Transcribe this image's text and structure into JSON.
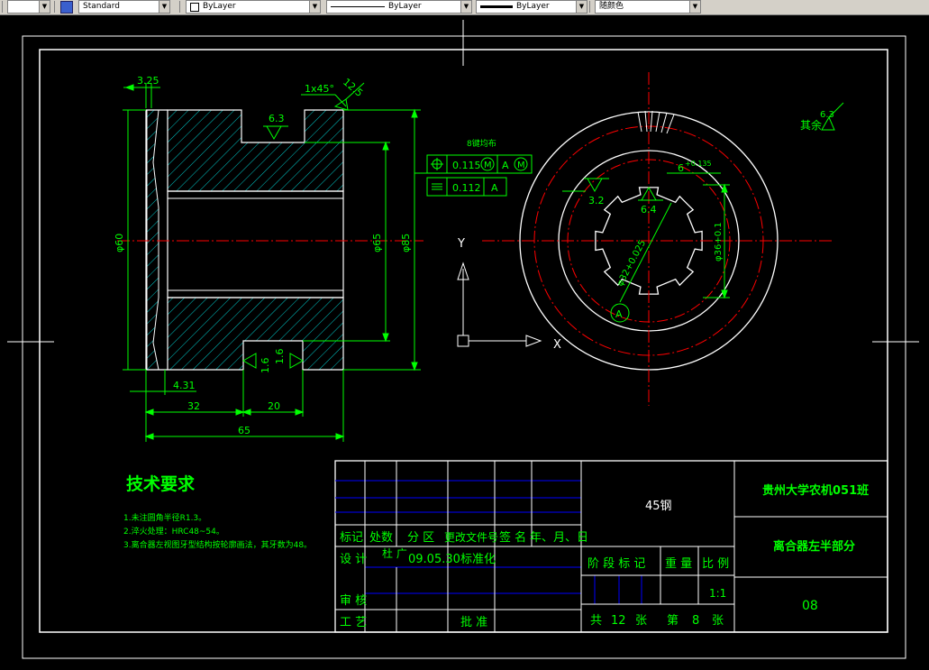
{
  "toolbar": {
    "text_style": "Standard",
    "layer": "ByLayer",
    "linetype": "ByLayer",
    "lineweight": "ByLayer",
    "color": "随颜色"
  },
  "colors": {
    "background": "#000000",
    "green": "#00ff00",
    "white": "#ffffff",
    "red": "#ff0000",
    "cyan": "#00c8c8",
    "blue": "#0000ff"
  },
  "drawing": {
    "dims": {
      "top_small": "3.25",
      "chamfer": "1x45°",
      "chamfer_angle": "12.5",
      "rough_top": "6.3",
      "dia_left": "φ60",
      "dia_65": "φ65",
      "dia_85": "φ85",
      "rough_b1": "1.6",
      "rough_b2": "1.6",
      "d431": "4.31",
      "d32": "32",
      "d20": "20",
      "d65": "65"
    },
    "tolerance": {
      "label": "8键均布",
      "row1_val": "0.115",
      "row1_m": "M",
      "row1_ref": "A",
      "row1_ref_m": "M",
      "row2_val": "0.112",
      "row2_ref": "A"
    },
    "right": {
      "dim6": "6",
      "dim6_tol": "+0.135",
      "r32": "3.2",
      "r64": "6.4",
      "d36": "φ36+0.1",
      "d32": "φ32+0.025",
      "datum": "A",
      "rest_label": "其余",
      "rest_rough": "6.3"
    },
    "ucs": {
      "y": "Y",
      "x": "X"
    },
    "tech": {
      "title": "技术要求",
      "line1": "1.未注圆角半径R1.3。",
      "line2": "2.淬火处理：HRC48~54。",
      "line3": "3.离合器左视图牙型结构按轮廓画法，其牙数为48。"
    },
    "title_block": {
      "material": "45钢",
      "school": "贵州大学农机051班",
      "part_name": "离合器左半部分",
      "drawing_no": "08",
      "h_mark": "标记",
      "h_count": "处数",
      "h_zone": "分 区",
      "h_change": "更改文件号",
      "h_sign": "签 名",
      "h_date": "年、月、日",
      "h_design": "设 计",
      "designer": "杜 广",
      "design_date": "09.05.30",
      "h_std": "标准化",
      "h_stage": "阶 段 标 记",
      "h_weight": "重 量",
      "h_scale": "比 例",
      "scale": "1:1",
      "h_review": "审 核",
      "h_process": "工 艺",
      "h_approve": "批 准",
      "total_pre": "共",
      "total": "12",
      "total_post": "张",
      "sheet_pre": "第",
      "sheet": "8",
      "sheet_post": "张"
    }
  }
}
